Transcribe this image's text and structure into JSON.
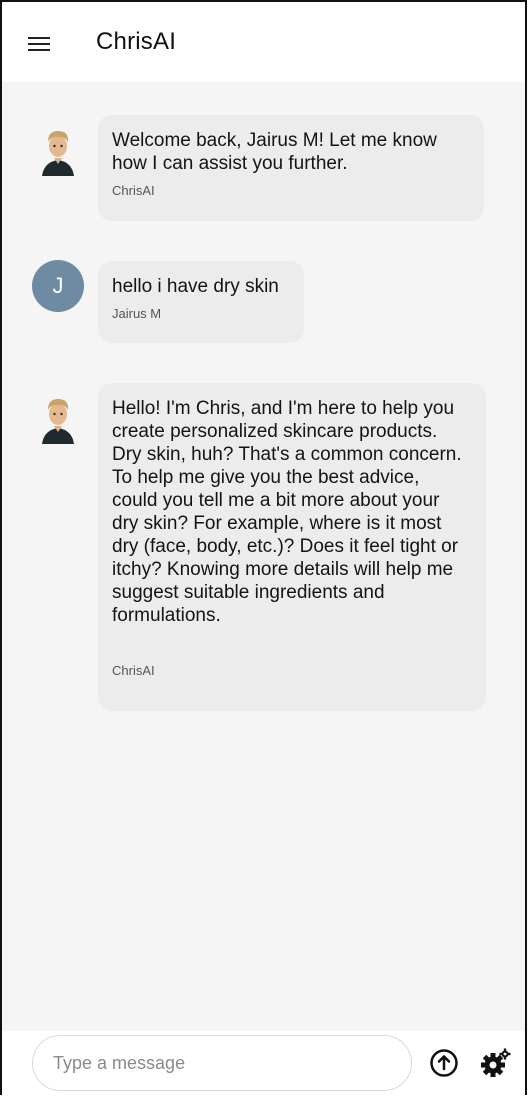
{
  "app": {
    "title": "ChrisAI"
  },
  "messages": [
    {
      "role": "assistant",
      "text": "Welcome back, Jairus M! Let me know how I can assist you further.",
      "sender": "ChrisAI"
    },
    {
      "role": "user",
      "avatar_initial": "J",
      "text": "hello i have dry skin",
      "sender": "Jairus M"
    },
    {
      "role": "assistant",
      "text": "Hello! I'm Chris, and I'm here to help you create personalized skincare products.  Dry skin, huh?  That's a common concern. To help me give you the best advice, could you tell me a bit more about your dry skin? For example, where is it most dry (face, body, etc.)? Does it feel tight or itchy?  Knowing more details will help me suggest suitable ingredients and formulations.",
      "sender": "ChrisAI"
    }
  ],
  "composer": {
    "placeholder": "Type a message",
    "value": ""
  },
  "icons": {
    "menu": "menu-icon",
    "send": "upload-arrow-icon",
    "settings": "gears-icon",
    "bot_avatar": "bot-avatar-icon"
  },
  "colors": {
    "background": "#f5f5f5",
    "bubble": "#ececec",
    "user_avatar": "#6f8aa3"
  }
}
